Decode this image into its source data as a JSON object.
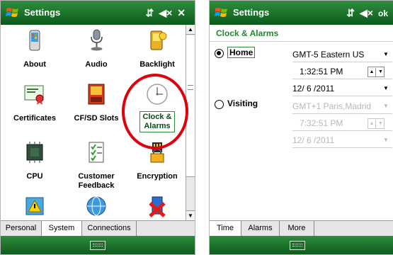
{
  "left_screen": {
    "title": "Settings",
    "status_icons": [
      "signal-icon",
      "volume-icon",
      "close-icon"
    ],
    "close_symbol": "✕",
    "tiles": [
      {
        "label": "About"
      },
      {
        "label": "Audio"
      },
      {
        "label": "Backlight"
      },
      {
        "label": "Certificates"
      },
      {
        "label": "CF/SD Slots"
      },
      {
        "label": "Clock &\nAlarms"
      },
      {
        "label": "CPU"
      },
      {
        "label": "Customer\nFeedback"
      },
      {
        "label": "Encryption"
      }
    ],
    "tabs": [
      "Personal",
      "System",
      "Connections"
    ],
    "active_tab": "System",
    "highlight_color": "#e0000a"
  },
  "right_screen": {
    "title": "Settings",
    "ok_label": "ok",
    "subheader": "Clock & Alarms",
    "home": {
      "label": "Home",
      "timezone": "GMT-5 Eastern US",
      "time": "1:32:51 PM",
      "date": "12/ 6 /2011",
      "selected": true
    },
    "visiting": {
      "label": "Visiting",
      "timezone": "GMT+1 Paris,Madrid",
      "time": "7:32:51 PM",
      "date": "12/ 6 /2011",
      "selected": false
    },
    "tabs": [
      "Time",
      "Alarms",
      "More"
    ],
    "active_tab": "Time"
  },
  "colors": {
    "titlebar_green": "#1b7a2c",
    "accent_green": "#218a31",
    "disabled_gray": "#b7b7b7"
  }
}
